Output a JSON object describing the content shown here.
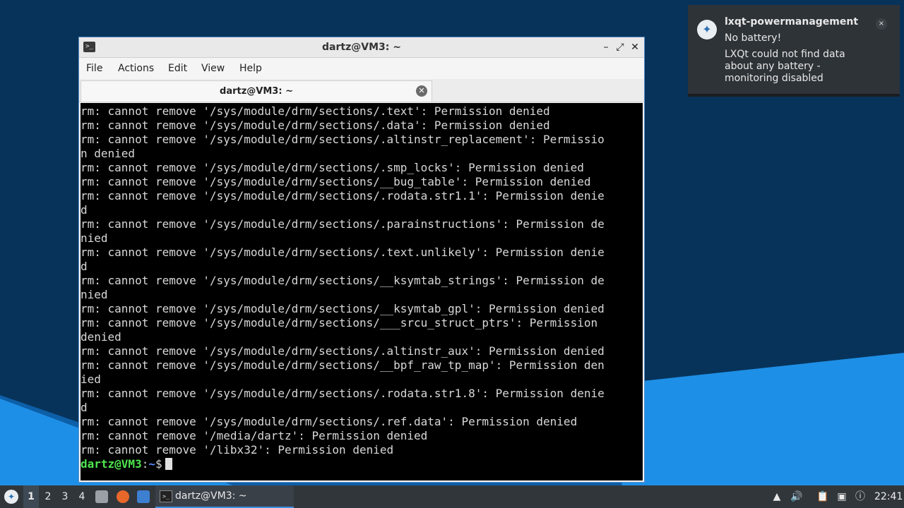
{
  "window": {
    "title": "dartz@VM3: ~",
    "buttons": {
      "minimize": "–",
      "maximize": "⤢",
      "close": "✕"
    }
  },
  "menubar": {
    "items": [
      "File",
      "Actions",
      "Edit",
      "View",
      "Help"
    ]
  },
  "tab": {
    "label": "dartz@VM3: ~",
    "close": "✕"
  },
  "terminal": {
    "lines": [
      "rm: cannot remove '/sys/module/drm/sections/.text': Permission denied",
      "rm: cannot remove '/sys/module/drm/sections/.data': Permission denied",
      "rm: cannot remove '/sys/module/drm/sections/.altinstr_replacement': Permissio",
      "n denied",
      "rm: cannot remove '/sys/module/drm/sections/.smp_locks': Permission denied",
      "rm: cannot remove '/sys/module/drm/sections/__bug_table': Permission denied",
      "rm: cannot remove '/sys/module/drm/sections/.rodata.str1.1': Permission denie",
      "d",
      "rm: cannot remove '/sys/module/drm/sections/.parainstructions': Permission de",
      "nied",
      "rm: cannot remove '/sys/module/drm/sections/.text.unlikely': Permission denie",
      "d",
      "rm: cannot remove '/sys/module/drm/sections/__ksymtab_strings': Permission de",
      "nied",
      "rm: cannot remove '/sys/module/drm/sections/__ksymtab_gpl': Permission denied",
      "rm: cannot remove '/sys/module/drm/sections/___srcu_struct_ptrs': Permission",
      "denied",
      "rm: cannot remove '/sys/module/drm/sections/.altinstr_aux': Permission denied",
      "rm: cannot remove '/sys/module/drm/sections/__bpf_raw_tp_map': Permission den",
      "ied",
      "rm: cannot remove '/sys/module/drm/sections/.rodata.str1.8': Permission denie",
      "d",
      "rm: cannot remove '/sys/module/drm/sections/.ref.data': Permission denied",
      "rm: cannot remove '/media/dartz': Permission denied",
      "rm: cannot remove '/libx32': Permission denied"
    ],
    "prompt": {
      "user": "dartz@VM3",
      "sep": ":",
      "path": "~",
      "symbol": "$"
    }
  },
  "notification": {
    "app": "lxqt-powermanagement",
    "summary": "No battery!",
    "body": "LXQt could not find data about any battery - monitoring disabled",
    "close": "×"
  },
  "taskbar": {
    "workspaces": [
      "1",
      "2",
      "3",
      "4"
    ],
    "active_workspace": "1",
    "task_label": "dartz@VM3: ~",
    "clock": "22:41"
  },
  "colors": {
    "desktop_dark": "#07335a",
    "desktop_light": "#1e8fe6",
    "prompt_user": "#4ee44e",
    "prompt_path": "#5b8cff"
  }
}
